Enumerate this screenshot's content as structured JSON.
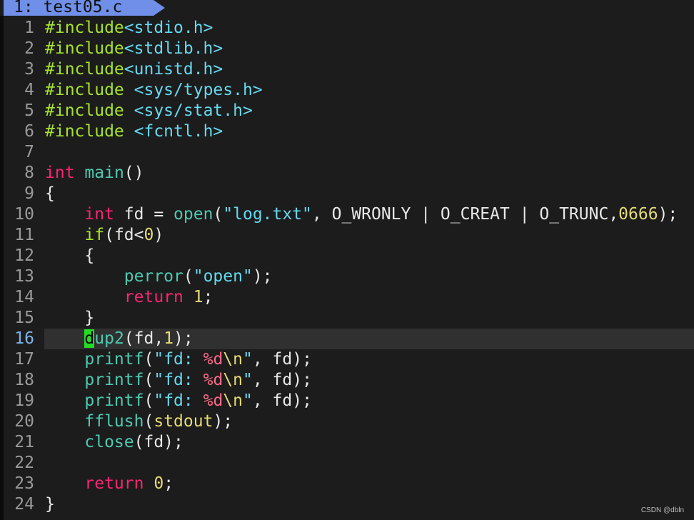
{
  "tab": {
    "label": "1: test05.c"
  },
  "current_line": 16,
  "lines": [
    {
      "num": "1",
      "tokens": [
        {
          "t": "#include",
          "c": "pre"
        },
        {
          "t": "<stdio.h>",
          "c": "inc"
        }
      ]
    },
    {
      "num": "2",
      "tokens": [
        {
          "t": "#include",
          "c": "pre"
        },
        {
          "t": "<stdlib.h>",
          "c": "inc"
        }
      ]
    },
    {
      "num": "3",
      "tokens": [
        {
          "t": "#include",
          "c": "pre"
        },
        {
          "t": "<unistd.h>",
          "c": "inc"
        }
      ]
    },
    {
      "num": "4",
      "tokens": [
        {
          "t": "#include",
          "c": "pre"
        },
        {
          "t": " ",
          "c": "punct"
        },
        {
          "t": "<sys/types.h>",
          "c": "inc"
        }
      ]
    },
    {
      "num": "5",
      "tokens": [
        {
          "t": "#include",
          "c": "pre"
        },
        {
          "t": " ",
          "c": "punct"
        },
        {
          "t": "<sys/stat.h>",
          "c": "inc"
        }
      ]
    },
    {
      "num": "6",
      "tokens": [
        {
          "t": "#include",
          "c": "pre"
        },
        {
          "t": " ",
          "c": "punct"
        },
        {
          "t": "<fcntl.h>",
          "c": "inc"
        }
      ]
    },
    {
      "num": "7",
      "tokens": []
    },
    {
      "num": "8",
      "tokens": [
        {
          "t": "int",
          "c": "kw"
        },
        {
          "t": " ",
          "c": "punct"
        },
        {
          "t": "main",
          "c": "fn"
        },
        {
          "t": "()",
          "c": "punct"
        }
      ]
    },
    {
      "num": "9",
      "tokens": [
        {
          "t": "{",
          "c": "punct"
        }
      ]
    },
    {
      "num": "10",
      "tokens": [
        {
          "t": "    ",
          "c": "punct"
        },
        {
          "t": "int",
          "c": "kw"
        },
        {
          "t": " fd = ",
          "c": "ident"
        },
        {
          "t": "open",
          "c": "fn"
        },
        {
          "t": "(",
          "c": "punct"
        },
        {
          "t": "\"log.txt\"",
          "c": "str"
        },
        {
          "t": ", O_WRONLY | O_CREAT | O_TRUNC,",
          "c": "const"
        },
        {
          "t": "0666",
          "c": "num"
        },
        {
          "t": ");",
          "c": "punct"
        }
      ]
    },
    {
      "num": "11",
      "tokens": [
        {
          "t": "    ",
          "c": "punct"
        },
        {
          "t": "if",
          "c": "pre"
        },
        {
          "t": "(fd<",
          "c": "punct"
        },
        {
          "t": "0",
          "c": "num"
        },
        {
          "t": ")",
          "c": "punct"
        }
      ]
    },
    {
      "num": "12",
      "tokens": [
        {
          "t": "    {",
          "c": "punct"
        }
      ]
    },
    {
      "num": "13",
      "tokens": [
        {
          "t": "        ",
          "c": "punct"
        },
        {
          "t": "perror",
          "c": "fn"
        },
        {
          "t": "(",
          "c": "punct"
        },
        {
          "t": "\"open\"",
          "c": "str"
        },
        {
          "t": ");",
          "c": "punct"
        }
      ]
    },
    {
      "num": "14",
      "tokens": [
        {
          "t": "        ",
          "c": "punct"
        },
        {
          "t": "return",
          "c": "kw"
        },
        {
          "t": " ",
          "c": "punct"
        },
        {
          "t": "1",
          "c": "num"
        },
        {
          "t": ";",
          "c": "punct"
        }
      ]
    },
    {
      "num": "15",
      "tokens": [
        {
          "t": "    }",
          "c": "punct"
        }
      ]
    },
    {
      "num": "16",
      "tokens": [
        {
          "t": "    ",
          "c": "punct"
        },
        {
          "t": "d",
          "c": "cursor"
        },
        {
          "t": "up2",
          "c": "fn"
        },
        {
          "t": "(fd,",
          "c": "punct"
        },
        {
          "t": "1",
          "c": "num"
        },
        {
          "t": ");",
          "c": "punct"
        }
      ]
    },
    {
      "num": "17",
      "tokens": [
        {
          "t": "    ",
          "c": "punct"
        },
        {
          "t": "printf",
          "c": "fn"
        },
        {
          "t": "(",
          "c": "punct"
        },
        {
          "t": "\"fd: ",
          "c": "str"
        },
        {
          "t": "%d",
          "c": "fmt"
        },
        {
          "t": "\\n",
          "c": "esc"
        },
        {
          "t": "\"",
          "c": "str"
        },
        {
          "t": ", fd);",
          "c": "punct"
        }
      ]
    },
    {
      "num": "18",
      "tokens": [
        {
          "t": "    ",
          "c": "punct"
        },
        {
          "t": "printf",
          "c": "fn"
        },
        {
          "t": "(",
          "c": "punct"
        },
        {
          "t": "\"fd: ",
          "c": "str"
        },
        {
          "t": "%d",
          "c": "fmt"
        },
        {
          "t": "\\n",
          "c": "esc"
        },
        {
          "t": "\"",
          "c": "str"
        },
        {
          "t": ", fd);",
          "c": "punct"
        }
      ]
    },
    {
      "num": "19",
      "tokens": [
        {
          "t": "    ",
          "c": "punct"
        },
        {
          "t": "printf",
          "c": "fn"
        },
        {
          "t": "(",
          "c": "punct"
        },
        {
          "t": "\"fd: ",
          "c": "str"
        },
        {
          "t": "%d",
          "c": "fmt"
        },
        {
          "t": "\\n",
          "c": "esc"
        },
        {
          "t": "\"",
          "c": "str"
        },
        {
          "t": ", fd);",
          "c": "punct"
        }
      ]
    },
    {
      "num": "20",
      "tokens": [
        {
          "t": "    ",
          "c": "punct"
        },
        {
          "t": "fflush",
          "c": "fn"
        },
        {
          "t": "(",
          "c": "punct"
        },
        {
          "t": "stdout",
          "c": "stdout"
        },
        {
          "t": ");",
          "c": "punct"
        }
      ]
    },
    {
      "num": "21",
      "tokens": [
        {
          "t": "    ",
          "c": "punct"
        },
        {
          "t": "close",
          "c": "fn"
        },
        {
          "t": "(fd);",
          "c": "punct"
        }
      ]
    },
    {
      "num": "22",
      "tokens": []
    },
    {
      "num": "23",
      "tokens": [
        {
          "t": "    ",
          "c": "punct"
        },
        {
          "t": "return",
          "c": "kw"
        },
        {
          "t": " ",
          "c": "punct"
        },
        {
          "t": "0",
          "c": "num"
        },
        {
          "t": ";",
          "c": "punct"
        }
      ]
    },
    {
      "num": "24",
      "tokens": [
        {
          "t": "}",
          "c": "punct"
        }
      ]
    }
  ],
  "watermark": "CSDN @dbln",
  "colors": {
    "background": "#1c1c1c",
    "tab_bg": "#6f8fe8",
    "cursor": "#22dd22",
    "current_line_bg": "#303030"
  }
}
